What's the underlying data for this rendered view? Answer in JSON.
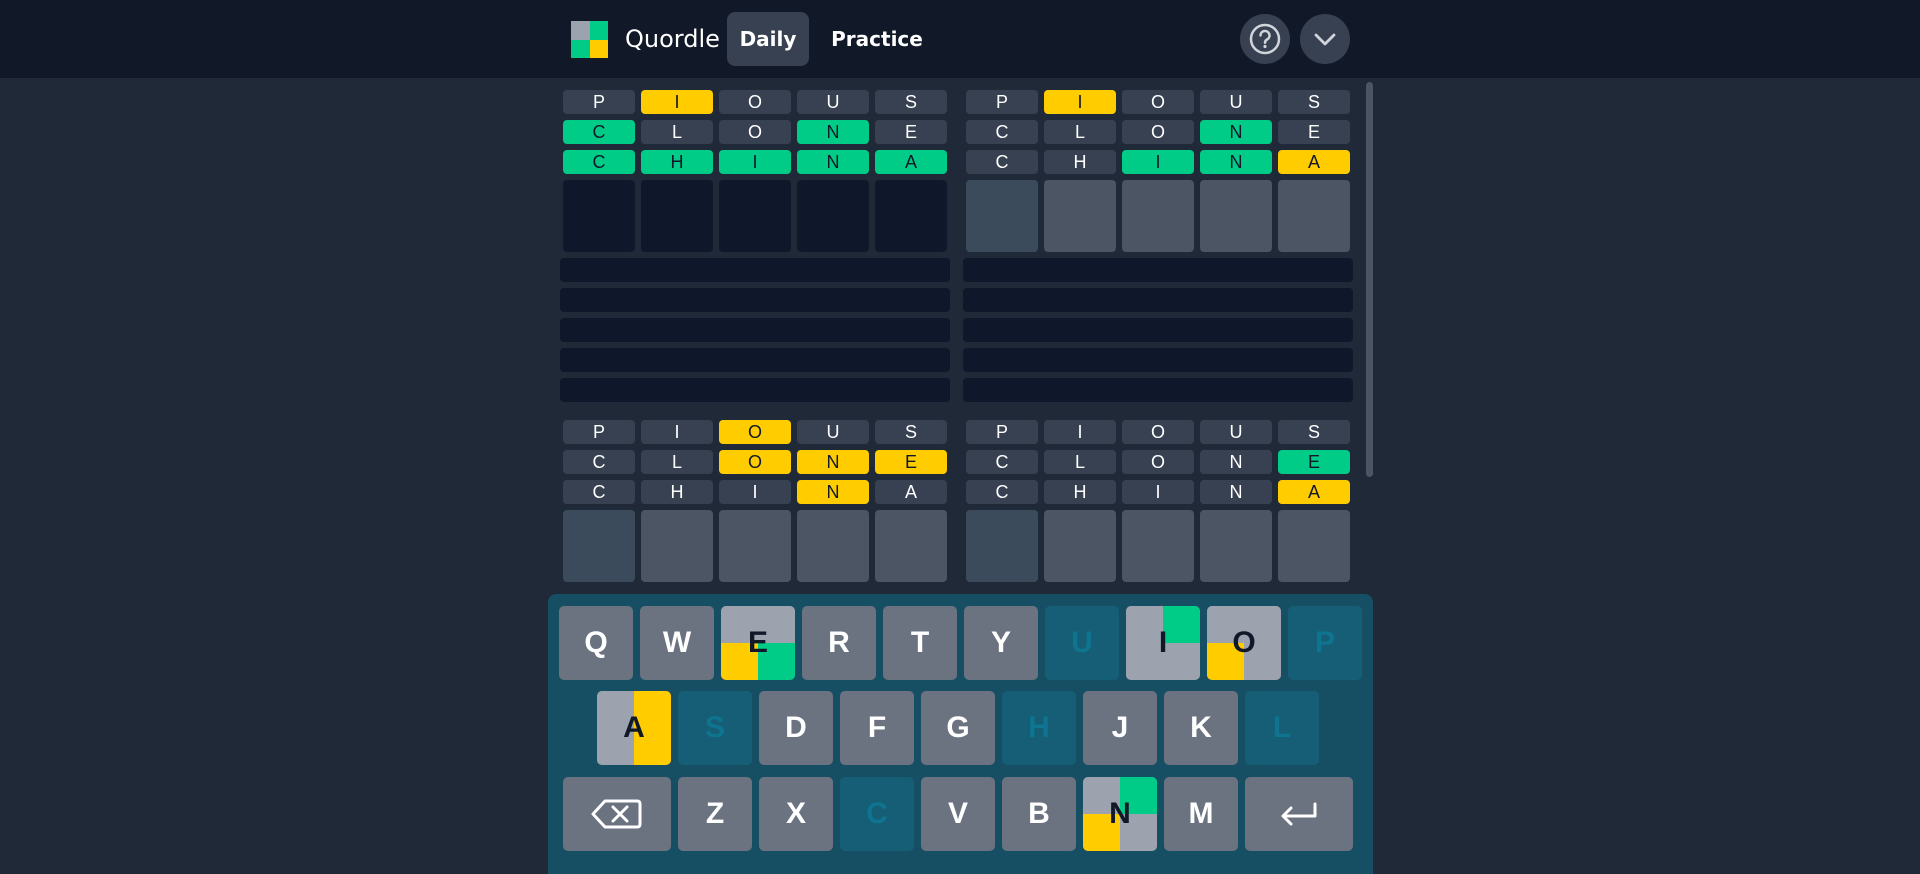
{
  "header": {
    "brand": "Quordle",
    "nav": [
      "Daily",
      "Practice"
    ],
    "logo_colors": [
      "#9ca3af",
      "#00cc88",
      "#00cc88",
      "#ffcc00"
    ],
    "help_icon": "question-circle-icon",
    "menu_icon": "chevron-down-icon"
  },
  "colors": {
    "correct": "#00cc88",
    "present": "#ffcc00",
    "absent": "#374151",
    "key_default": "#6b7280",
    "key_absent": "#155e75",
    "key_absent_text": "#0e7490"
  },
  "boards": [
    {
      "guesses": [
        {
          "letters": [
            "P",
            "I",
            "O",
            "U",
            "S"
          ],
          "states": [
            "a",
            "p",
            "a",
            "a",
            "a"
          ]
        },
        {
          "letters": [
            "C",
            "L",
            "O",
            "N",
            "E"
          ],
          "states": [
            "c",
            "a",
            "a",
            "c",
            "a"
          ]
        },
        {
          "letters": [
            "C",
            "H",
            "I",
            "N",
            "A"
          ],
          "states": [
            "c",
            "c",
            "c",
            "c",
            "c"
          ]
        }
      ]
    },
    {
      "guesses": [
        {
          "letters": [
            "P",
            "I",
            "O",
            "U",
            "S"
          ],
          "states": [
            "a",
            "p",
            "a",
            "a",
            "a"
          ]
        },
        {
          "letters": [
            "C",
            "L",
            "O",
            "N",
            "E"
          ],
          "states": [
            "a",
            "a",
            "a",
            "c",
            "a"
          ]
        },
        {
          "letters": [
            "C",
            "H",
            "I",
            "N",
            "A"
          ],
          "states": [
            "a",
            "a",
            "c",
            "c",
            "p"
          ]
        }
      ]
    },
    {
      "guesses": [
        {
          "letters": [
            "P",
            "I",
            "O",
            "U",
            "S"
          ],
          "states": [
            "a",
            "a",
            "p",
            "a",
            "a"
          ]
        },
        {
          "letters": [
            "C",
            "L",
            "O",
            "N",
            "E"
          ],
          "states": [
            "a",
            "a",
            "p",
            "p",
            "p"
          ]
        },
        {
          "letters": [
            "C",
            "H",
            "I",
            "N",
            "A"
          ],
          "states": [
            "a",
            "a",
            "a",
            "p",
            "a"
          ]
        }
      ]
    },
    {
      "guesses": [
        {
          "letters": [
            "P",
            "I",
            "O",
            "U",
            "S"
          ],
          "states": [
            "a",
            "a",
            "a",
            "a",
            "a"
          ]
        },
        {
          "letters": [
            "C",
            "L",
            "O",
            "N",
            "E"
          ],
          "states": [
            "a",
            "a",
            "a",
            "a",
            "c"
          ]
        },
        {
          "letters": [
            "C",
            "H",
            "I",
            "N",
            "A"
          ],
          "states": [
            "a",
            "a",
            "a",
            "a",
            "p"
          ]
        }
      ]
    }
  ],
  "keyboard": {
    "rows": [
      [
        {
          "label": "Q",
          "state": "default"
        },
        {
          "label": "W",
          "state": "default"
        },
        {
          "label": "E",
          "state": "mixed",
          "quads": [
            "#9ca3af",
            "#9ca3af",
            "#ffcc00",
            "#00cc88"
          ]
        },
        {
          "label": "R",
          "state": "default"
        },
        {
          "label": "T",
          "state": "default"
        },
        {
          "label": "Y",
          "state": "default"
        },
        {
          "label": "U",
          "state": "absent"
        },
        {
          "label": "I",
          "state": "mixed",
          "quads": [
            "#9ca3af",
            "#00cc88",
            "#9ca3af",
            "#9ca3af"
          ]
        },
        {
          "label": "O",
          "state": "mixed",
          "quads": [
            "#9ca3af",
            "#9ca3af",
            "#ffcc00",
            "#9ca3af"
          ]
        },
        {
          "label": "P",
          "state": "absent"
        }
      ],
      [
        {
          "label": "A",
          "state": "mixed",
          "quads": [
            "#9ca3af",
            "#ffcc00",
            "#9ca3af",
            "#ffcc00"
          ]
        },
        {
          "label": "S",
          "state": "absent"
        },
        {
          "label": "D",
          "state": "default"
        },
        {
          "label": "F",
          "state": "default"
        },
        {
          "label": "G",
          "state": "default"
        },
        {
          "label": "H",
          "state": "absent"
        },
        {
          "label": "J",
          "state": "default"
        },
        {
          "label": "K",
          "state": "default"
        },
        {
          "label": "L",
          "state": "absent"
        }
      ],
      [
        {
          "label": "",
          "state": "default",
          "icon": "backspace-icon"
        },
        {
          "label": "Z",
          "state": "default"
        },
        {
          "label": "X",
          "state": "default"
        },
        {
          "label": "C",
          "state": "absent"
        },
        {
          "label": "V",
          "state": "default"
        },
        {
          "label": "B",
          "state": "default"
        },
        {
          "label": "N",
          "state": "mixed",
          "quads": [
            "#9ca3af",
            "#00cc88",
            "#ffcc00",
            "#9ca3af"
          ]
        },
        {
          "label": "M",
          "state": "default"
        },
        {
          "label": "",
          "state": "default",
          "icon": "enter-icon"
        }
      ]
    ]
  }
}
